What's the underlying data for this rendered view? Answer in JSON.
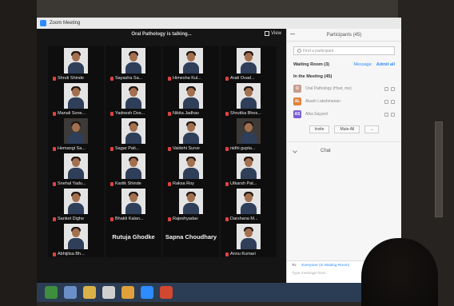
{
  "window": {
    "title": "Zoom Meeting"
  },
  "video": {
    "talking_label": "Oral Pathology is talking...",
    "view_label": "View"
  },
  "tiles": [
    {
      "name": "Shruti Shinde"
    },
    {
      "name": "Sayasha Sa..."
    },
    {
      "name": "Himesha Kul..."
    },
    {
      "name": "Arati Ovad..."
    },
    {
      "name": "Manali Sone..."
    },
    {
      "name": "Yadnesh Dos..."
    },
    {
      "name": "Nikita Jadhav"
    },
    {
      "name": "Shrutika Bhos..."
    },
    {
      "name": "Hemangi Sa..."
    },
    {
      "name": "Sagar Pati..."
    },
    {
      "name": "Vaidehi Surve"
    },
    {
      "name": "nidhi gupta..."
    },
    {
      "name": "Snehal Yadu..."
    },
    {
      "name": "Kartik Shinde"
    },
    {
      "name": "Raksa Roy"
    },
    {
      "name": "Utkarsh Pat..."
    },
    {
      "name": "Sanket Dighe"
    },
    {
      "name": "Bhakti Kalan..."
    },
    {
      "name": "Rajeshyadav"
    },
    {
      "name": "Darshana M..."
    },
    {
      "name": "Abhijitsa Bh..."
    },
    {
      "name": "Rutuja Ghodke",
      "no_video": true
    },
    {
      "name": "Sapna Choudhary",
      "no_video": true
    },
    {
      "name": "Annu Kumari"
    }
  ],
  "participants_panel": {
    "title": "Participants (45)",
    "search_placeholder": "Find a participant",
    "waiting_room_label": "Waiting Room (3)",
    "message_label": "Message",
    "admit_all_label": "Admit all",
    "in_meeting_label": "In the Meeting (45)",
    "participants": [
      {
        "initials": "O",
        "name": "Oral Pathology (Host, me)",
        "color": "#c89b8a"
      },
      {
        "initials": "AL",
        "name": "Akash Lakshmanan",
        "color": "#e0823d"
      },
      {
        "initials": "AS",
        "name": "Alka Sayyed",
        "color": "#7a5fd1"
      }
    ],
    "invite_label": "Invite",
    "mute_all_label": "Mute All",
    "more_label": "...",
    "chat_label": "Chat",
    "to_label": "To:",
    "to_target": "Everyone (in Waiting Room)",
    "message_placeholder": "Type message here..."
  },
  "colors": {
    "accent": "#2d8cff",
    "mic_off": "#e24040",
    "taskbar": "#2b3c55"
  }
}
